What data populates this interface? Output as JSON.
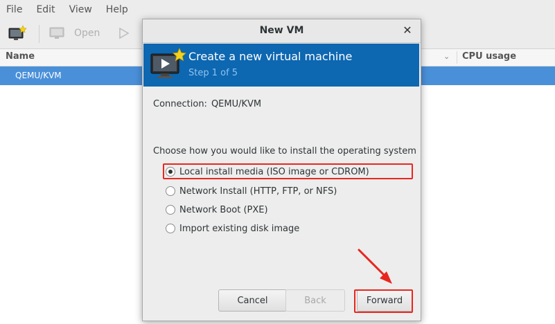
{
  "menubar": {
    "items": [
      "File",
      "Edit",
      "View",
      "Help"
    ]
  },
  "toolbar": {
    "open_label": "Open"
  },
  "list": {
    "columns": {
      "name": "Name",
      "cpu": "CPU usage"
    },
    "rows": [
      "QEMU/KVM"
    ]
  },
  "dialog": {
    "title": "New VM",
    "close_glyph": "✕",
    "header_title": "Create a new virtual machine",
    "header_step": "Step 1 of 5",
    "connection_label": "Connection:",
    "connection_value": "QEMU/KVM",
    "choose_label": "Choose how you would like to install the operating system",
    "options": [
      {
        "label": "Local install media (ISO image or CDROM)",
        "checked": true
      },
      {
        "label": "Network Install (HTTP, FTP, or NFS)",
        "checked": false
      },
      {
        "label": "Network Boot (PXE)",
        "checked": false
      },
      {
        "label": "Import existing disk image",
        "checked": false
      }
    ],
    "buttons": {
      "cancel": "Cancel",
      "back": "Back",
      "forward": "Forward"
    }
  },
  "colors": {
    "header_blue": "#0d67b1",
    "selection_blue": "#4a90d9",
    "annotation_red": "#e8261f"
  }
}
